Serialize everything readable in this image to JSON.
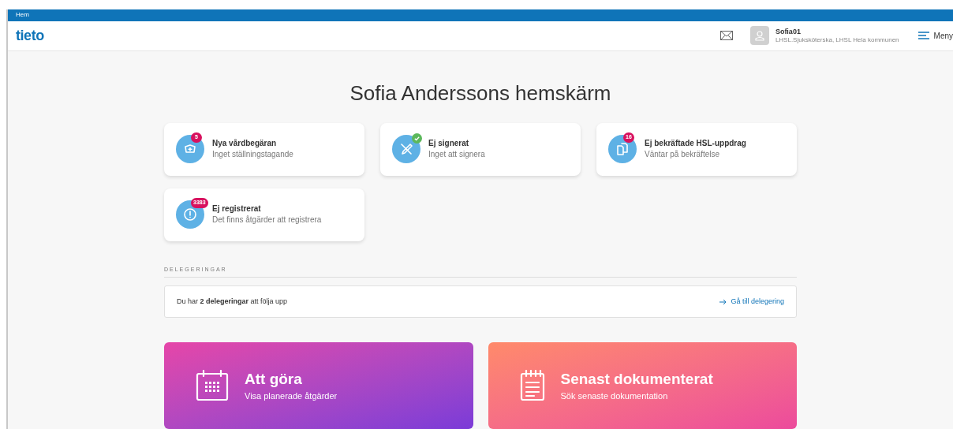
{
  "breadcrumb": "Hem",
  "header": {
    "logo": "tieto",
    "user": {
      "name": "Sofia01",
      "role": "LHSL.Sjuksköterska, LHSL Hela kommunen"
    },
    "menu": "Meny"
  },
  "title": "Sofia Anderssons hemskärm",
  "cards": [
    {
      "badge": {
        "kind": "count",
        "text": "5"
      },
      "title": "Nya vårdbegäran",
      "subtitle": "Inget ställningstagande"
    },
    {
      "badge": {
        "kind": "check"
      },
      "title": "Ej signerat",
      "subtitle": "Inget att signera"
    },
    {
      "badge": {
        "kind": "count",
        "text": "16"
      },
      "title": "Ej bekräftade HSL-uppdrag",
      "subtitle": "Väntar på bekräftelse"
    },
    {
      "badge": {
        "kind": "count",
        "text": "3383"
      },
      "title": "Ej registrerat",
      "subtitle": "Det finns åtgärder att registrera"
    }
  ],
  "delegations": {
    "heading": "DELEGERINGAR",
    "message": "Du har **2 delegeringar** att följa upp",
    "link": "Gå till delegering"
  },
  "tiles": [
    {
      "title": "Att göra",
      "subtitle": "Visa planerade åtgärder"
    },
    {
      "title": "Senast dokumenterat",
      "subtitle": "Sök senaste dokumentation"
    }
  ]
}
